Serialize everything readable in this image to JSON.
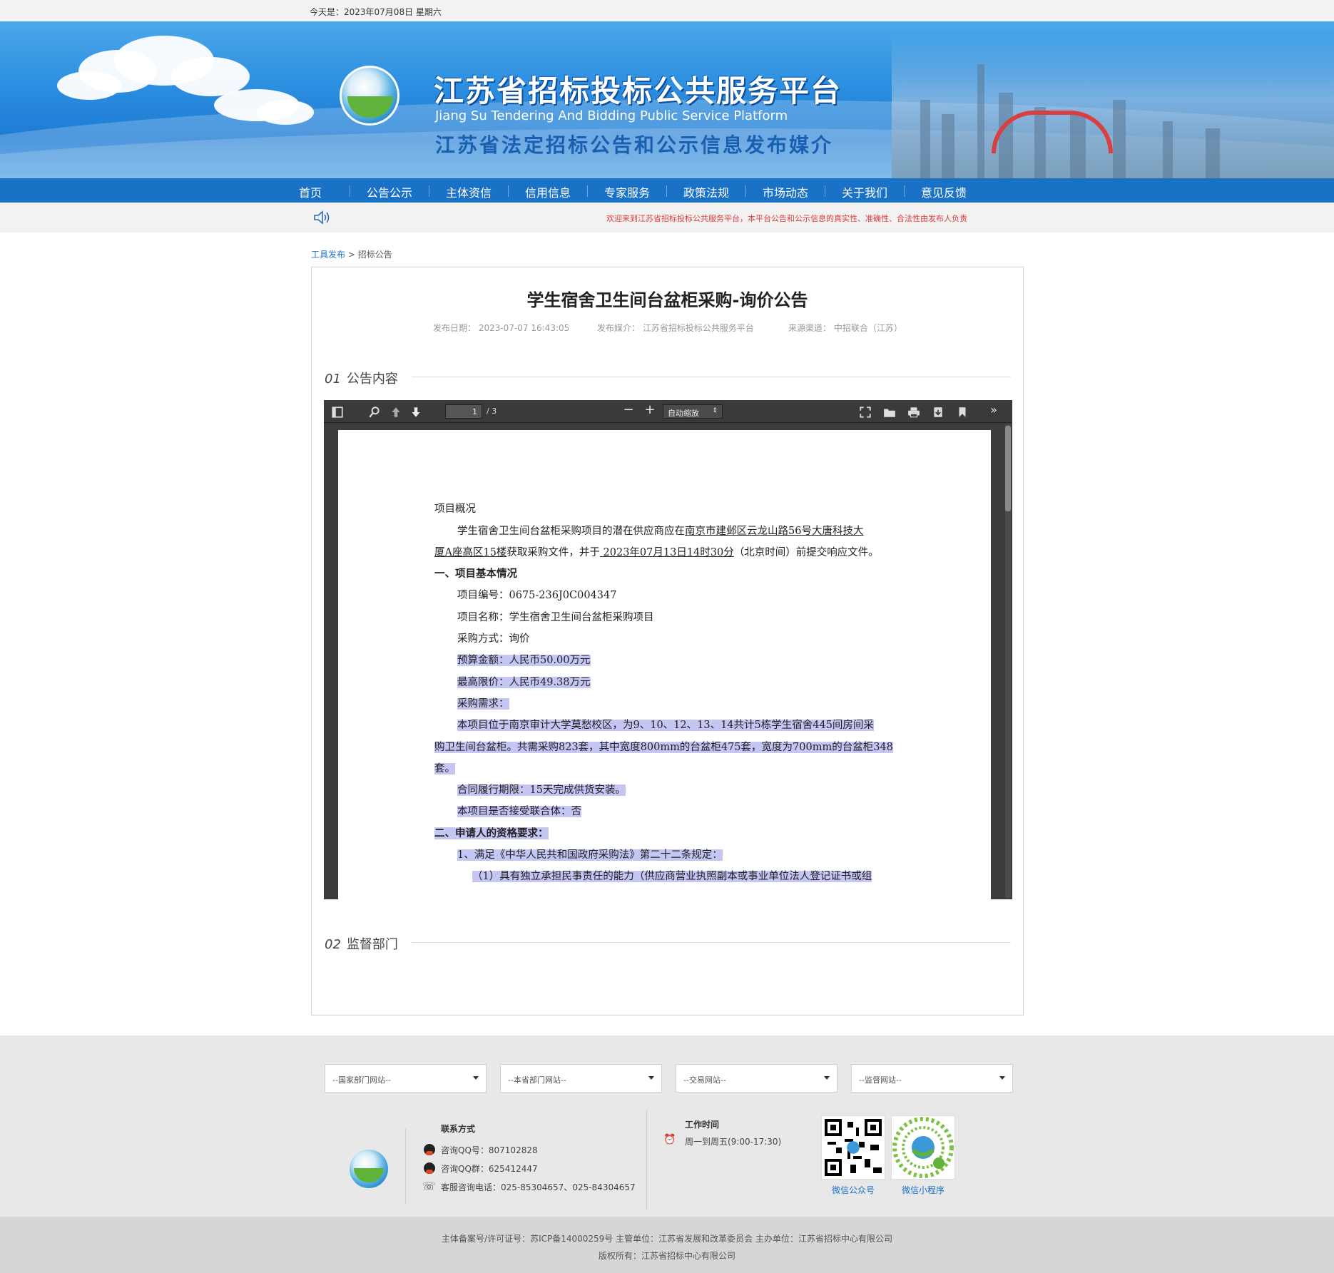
{
  "topbar": {
    "date_text": "今天是：2023年07月08日 星期六"
  },
  "header": {
    "title_cn": "江苏省招标投标公共服务平台",
    "title_en": "Jiang Su Tendering And Bidding Public Service Platform",
    "subtitle": "江苏省法定招标公告和公示信息发布媒介"
  },
  "nav": {
    "items": [
      {
        "label": "首页"
      },
      {
        "label": "公告公示"
      },
      {
        "label": "主体资信"
      },
      {
        "label": "信用信息"
      },
      {
        "label": "专家服务"
      },
      {
        "label": "政策法规"
      },
      {
        "label": "市场动态"
      },
      {
        "label": "关于我们"
      },
      {
        "label": "意见反馈"
      }
    ]
  },
  "notice": {
    "message": "欢迎来到江苏省招标投标公共服务平台，本平台公告和公示信息的真实性、准确性、合法性由发布人负责"
  },
  "breadcrumb": {
    "link": "工具发布",
    "separator": ">",
    "current": "招标公告"
  },
  "article": {
    "title": "学生宿舍卫生间台盆柜采购-询价公告",
    "publish_date": "发布日期： 2023-07-07 16:43:05",
    "publish_media": "发布媒介： 江苏省招标投标公共服务平台",
    "source": "来源渠道： 中招联合（江苏）"
  },
  "sections": {
    "s1_num": "01",
    "s1_title": "公告内容",
    "s2_num": "02",
    "s2_title": "监督部门"
  },
  "pdf_viewer": {
    "page_current": "1",
    "page_total": "/ 3",
    "zoom": "自动缩放",
    "lines": {
      "l1": "项目概况",
      "l2a": "学生宿舍卫生间台盆柜采购项目的潜在供应商应在",
      "l2b": "南京市建邺区云龙山路56号大唐科技大",
      "l3a": "厦A座高区15楼",
      "l3b": "获取采购文件，并于",
      "l3c": " 2023年07月13日14时30分",
      "l3d": "（北京时间）前提交响应文件。",
      "l4": "一、项目基本情况",
      "l5": "项目编号：0675-236J0C004347",
      "l6": "项目名称：学生宿舍卫生间台盆柜采购项目",
      "l7": "采购方式：询价",
      "l8": "预算金额：人民币50.00万元",
      "l9": "最高限价：人民币49.38万元",
      "l10": "采购需求：",
      "l11": "本项目位于南京审计大学莫愁校区，为9、10、12、13、14共计5栋学生宿舍445间房间采",
      "l12": "购卫生间台盆柜。共需采购823套，其中宽度800mm的台盆柜475套，宽度为700mm的台盆柜348",
      "l13": "套。",
      "l14": "合同履行期限：15天完成供货安装。",
      "l15": "本项目是否接受联合体：否",
      "l16": "二、申请人的资格要求：",
      "l17": "1、满足《中华人民共和国政府采购法》第二十二条规定：",
      "l18": "（1）具有独立承担民事责任的能力（供应商营业执照副本或事业单位法人登记证书或组"
    }
  },
  "footer": {
    "selects": [
      "--国家部门网站--",
      "--本省部门网站--",
      "--交易网站--",
      "--监督网站--"
    ],
    "contact_title": "联系方式",
    "qq": "咨询QQ号：807102828",
    "qq_group": "咨询QQ群：625412447",
    "phone": "客服咨询电话：025-85304657、025-84304657",
    "work_title": "工作时间",
    "work_hours": "周一到周五(9:00-17:30)",
    "qr1_label": "微信公众号",
    "qr2_label": "微信小程序",
    "icp": "主体备案号/许可证号：苏ICP备14000259号 主管单位：江苏省发展和改革委员会 主办单位：江苏省招标中心有限公司",
    "copyright": "版权所有：江苏省招标中心有限公司"
  },
  "colors": {
    "nav_bg": "#1a72c7",
    "notice_text": "#e23b3b",
    "highlight": "#c6c6f5"
  }
}
